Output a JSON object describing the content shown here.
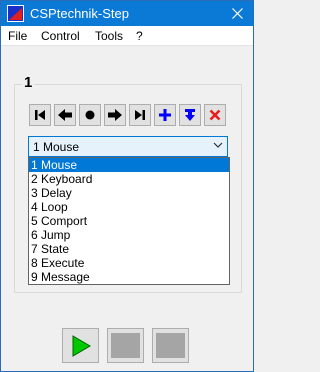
{
  "window": {
    "title": "CSPtechnik-Step",
    "close_glyph": "✕"
  },
  "menu": {
    "items": [
      "File",
      "Control",
      "Tools",
      "?"
    ]
  },
  "step": {
    "number": "1"
  },
  "toolbar": {
    "icons": [
      "first-step-icon",
      "previous-step-icon",
      "record-icon",
      "next-step-icon",
      "last-step-icon",
      "add-step-icon",
      "insert-step-icon",
      "delete-step-icon"
    ],
    "accent_blue": "#0000ff",
    "delete_red": "#e61e1e"
  },
  "combo": {
    "selected": "1 Mouse"
  },
  "dropdown": {
    "options": [
      "1 Mouse",
      "2 Keyboard",
      "3 Delay",
      "4 Loop",
      "5 Comport",
      "6 Jump",
      "7 State",
      "8 Execute",
      "9 Message"
    ],
    "selected_index": 0,
    "highlight_color": "#0078d7"
  },
  "runbar": {
    "icons": [
      "play-icon",
      "disabled-button-icon",
      "disabled-button-icon"
    ],
    "play_color": "#00c800"
  }
}
